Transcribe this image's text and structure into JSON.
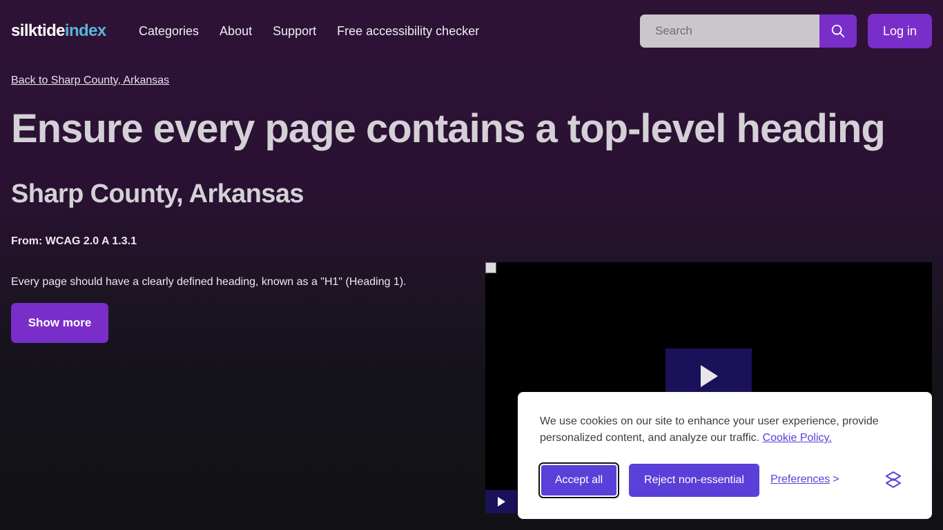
{
  "header": {
    "logo_part1": "silktide",
    "logo_part2": "index",
    "nav": [
      "Categories",
      "About",
      "Support",
      "Free accessibility checker"
    ],
    "search_placeholder": "Search",
    "login_label": "Log in"
  },
  "main": {
    "back_link": "Back to Sharp County, Arkansas",
    "title": "Ensure every page contains a top-level heading",
    "subtitle": "Sharp County, Arkansas",
    "from": "From: WCAG 2.0 A 1.3.1",
    "description": "Every page should have a clearly defined heading, known as a \"H1\" (Heading 1).",
    "show_more_label": "Show more"
  },
  "cookie": {
    "text": "We use cookies on our site to enhance your user experience, provide personalized content, and analyze our traffic.",
    "policy_link": "Cookie Policy.",
    "accept_label": "Accept all",
    "reject_label": "Reject non-essential",
    "preferences_label": "Preferences",
    "preferences_arrow": ">"
  },
  "icons": {
    "search": "search-icon",
    "play": "play-icon",
    "silktide": "silktide-logo-icon"
  },
  "colors": {
    "accent_purple": "#7a2ec9",
    "cookie_button": "#5a3fd8",
    "logo_index": "#5ab6d8"
  }
}
